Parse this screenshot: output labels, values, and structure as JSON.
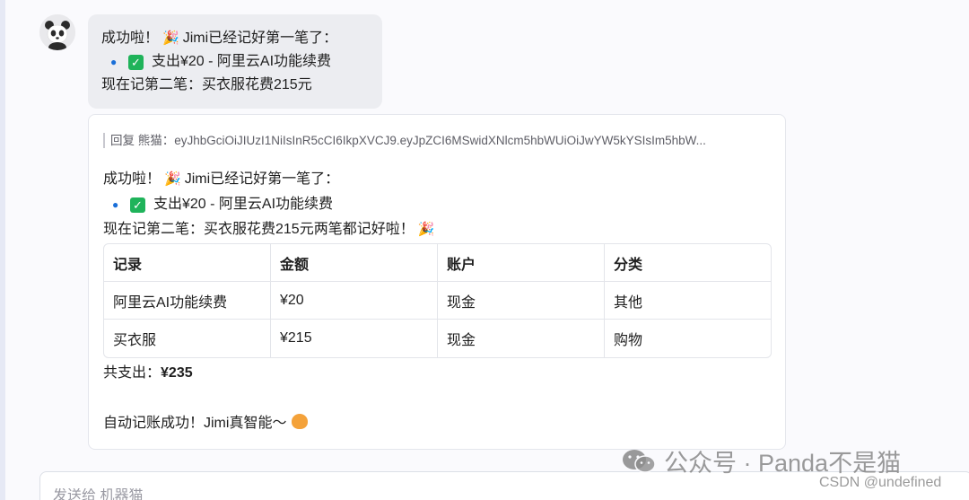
{
  "message": {
    "line1_text": "成功啦！",
    "line1_emoji": "🎉",
    "line1_rest": "Jimi已经记好第一笔了：",
    "item_text": "支出¥20 - 阿里云AI功能续费",
    "line3": "现在记第二笔：买衣服花费215元"
  },
  "reply": {
    "quote": "回复 熊猫：eyJhbGciOiJIUzI1NiIsInR5cCI6IkpXVCJ9.eyJpZCI6MSwidXNlcm5hbWUiOiJwYW5kYSIsIm5hbW...",
    "line1_text": "成功啦！",
    "line1_emoji": "🎉",
    "line1_rest": "Jimi已经记好第一笔了：",
    "item_text": "支出¥20 - 阿里云AI功能续费",
    "line3": "现在记第二笔：买衣服花费215元两笔都记好啦！",
    "line3_emoji": "🎉",
    "table": {
      "headers": [
        "记录",
        "金额",
        "账户",
        "分类"
      ],
      "rows": [
        [
          "阿里云AI功能续费",
          "¥20",
          "现金",
          "其他"
        ],
        [
          "买衣服",
          "¥215",
          "现金",
          "购物"
        ]
      ]
    },
    "total_label": "共支出：",
    "total_value": "¥235",
    "footer": "自动记账成功！Jimi真智能～"
  },
  "watermark": {
    "text": "公众号 · Panda不是猫",
    "csdn": "CSDN @undefined"
  },
  "input": {
    "placeholder": "发送给 机器猫"
  },
  "colors": {
    "bubble_bg": "#ecedf1",
    "check_green": "#1fb35a",
    "bullet_blue": "#1a6fd8"
  }
}
